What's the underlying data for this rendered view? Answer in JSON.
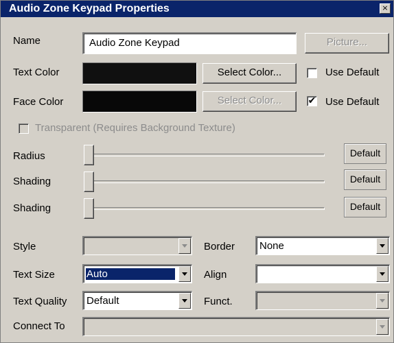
{
  "window": {
    "title": "Audio Zone Keypad Properties",
    "close_label": "×"
  },
  "name_row": {
    "label": "Name",
    "value": "Audio Zone Keypad",
    "picture_button": "Picture..."
  },
  "text_color": {
    "label": "Text Color",
    "swatch_color": "#101010",
    "select_button": "Select Color...",
    "use_default_label": "Use Default",
    "use_default_checked": false
  },
  "face_color": {
    "label": "Face Color",
    "swatch_color": "#080808",
    "select_button": "Select Color...",
    "use_default_label": "Use Default",
    "use_default_checked": true,
    "check_mark": "✔"
  },
  "transparent": {
    "label": "Transparent (Requires Background Texture)",
    "checked": false
  },
  "sliders": [
    {
      "label": "Radius",
      "default_label": "Default"
    },
    {
      "label": "Shading",
      "default_label": "Default"
    },
    {
      "label": "Shading",
      "default_label": "Default"
    }
  ],
  "style": {
    "label": "Style",
    "value": ""
  },
  "border": {
    "label": "Border",
    "value": "None"
  },
  "text_size": {
    "label": "Text Size",
    "value": "Auto"
  },
  "align": {
    "label": "Align",
    "value": ""
  },
  "text_quality": {
    "label": "Text Quality",
    "value": "Default"
  },
  "funct": {
    "label": "Funct.",
    "value": ""
  },
  "connect_to": {
    "label": "Connect To",
    "value": ""
  }
}
